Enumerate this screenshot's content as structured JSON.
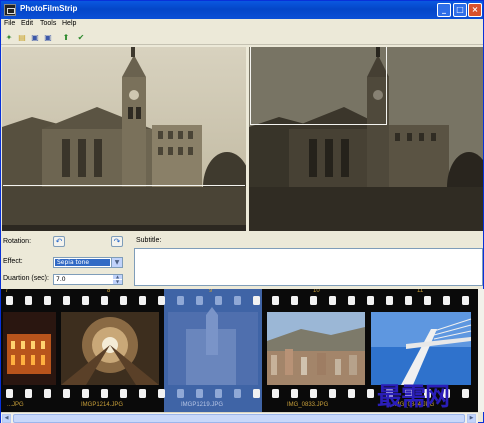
{
  "window": {
    "title": "PhotoFilmStrip",
    "minimize": "_",
    "maximize": "□",
    "close": "×"
  },
  "menu": {
    "file": "File",
    "edit": "Edit",
    "tools": "Tools",
    "help": "Help"
  },
  "toolbar": {
    "icons": [
      "new-project-icon",
      "open-icon",
      "save-icon",
      "save-as-icon",
      "import-icon",
      "render-icon"
    ],
    "glyphs": [
      "✦",
      "▤",
      "▣",
      "▣",
      "⬆",
      "✔"
    ]
  },
  "controls": {
    "rotation_label": "Rotation:",
    "rotate_left": "↶",
    "rotate_right": "↷",
    "effect_label": "Effect:",
    "effect_value": "Sepia tone",
    "duration_label": "Duartion (sec):",
    "duration_value": "7.0",
    "subtitle_label": "Subtitle:"
  },
  "filmstrip": {
    "frame_numbers": [
      "7",
      "8",
      "9",
      "10",
      "11"
    ],
    "images": [
      {
        "name": "...JPG",
        "caption": "...JPG"
      },
      {
        "name": "IMGP1214.JPG",
        "caption": "IMGP1214.JPG"
      },
      {
        "name": "IMGP1219.JPG",
        "caption": "IMGP1219.JPG"
      },
      {
        "name": "IMG_0833.JPG",
        "caption": "IMG_0833.JPG"
      },
      {
        "name": "IMG_0844.JPG",
        "caption": "IMG_0844.JPG"
      }
    ]
  },
  "watermark": "最需网",
  "colors": {
    "title_bar": "#0446c8",
    "selection": "#316ac5",
    "sepia_dark": "#3c3a33"
  }
}
